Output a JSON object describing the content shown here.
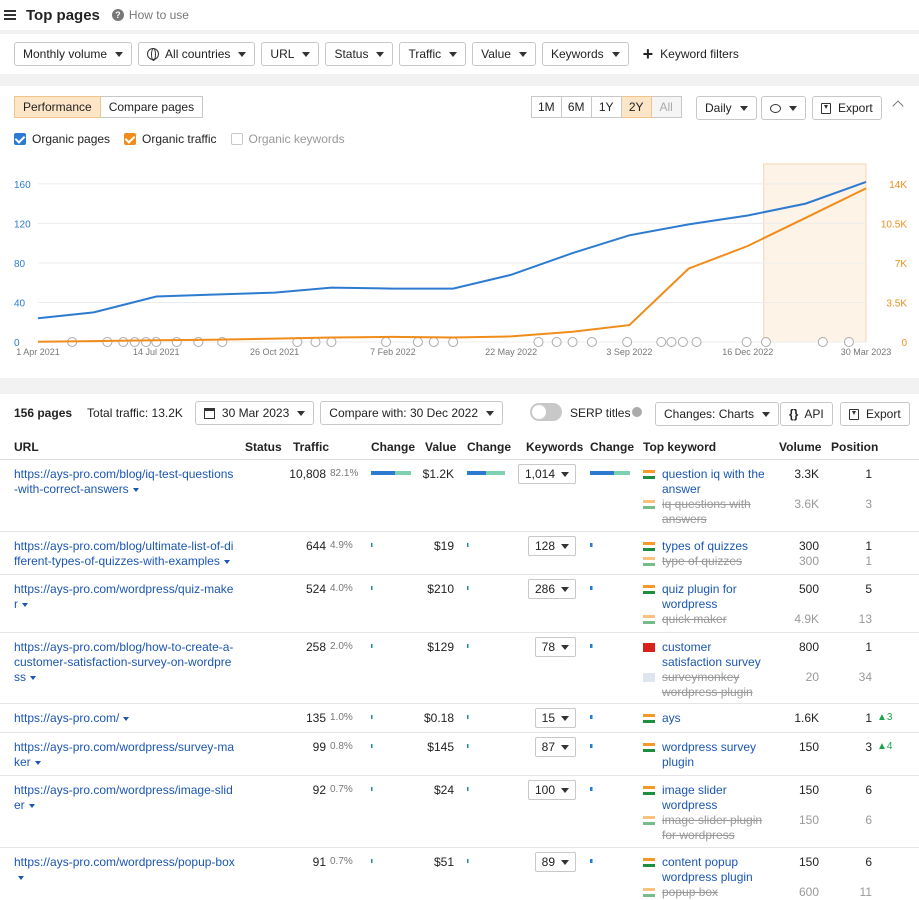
{
  "header": {
    "title": "Top pages",
    "help": "How to use"
  },
  "filters": [
    "Monthly volume",
    "All countries",
    "URL",
    "Status",
    "Traffic",
    "Value",
    "Keywords"
  ],
  "keyword_filters": "Keyword filters",
  "performance": {
    "tabs": [
      "Performance",
      "Compare pages"
    ],
    "ranges": [
      "1M",
      "6M",
      "1Y",
      "2Y",
      "All"
    ],
    "granularity": "Daily",
    "export": "Export",
    "legend": [
      "Organic pages",
      "Organic traffic",
      "Organic keywords"
    ],
    "colors": {
      "pages": "#2d7bd0",
      "traffic": "#f08c1a",
      "highlight": "#fdf3e7"
    }
  },
  "chart_data": {
    "type": "line",
    "x_labels": [
      "1 Apr 2021",
      "14 Jul 2021",
      "26 Oct 2021",
      "7 Feb 2022",
      "22 May 2022",
      "3 Sep 2022",
      "16 Dec 2022",
      "30 Mar 2023"
    ],
    "y_left_ticks": [
      "0",
      "40",
      "80",
      "120",
      "160"
    ],
    "y_right_ticks": [
      "0",
      "3.5K",
      "7K",
      "10.5K",
      "14K"
    ],
    "ylim_left": [
      0,
      170
    ],
    "ylim_right": [
      0,
      14875
    ],
    "highlight_range": [
      "30 Dec 2022",
      "30 Mar 2023"
    ],
    "series": [
      {
        "name": "Organic pages",
        "axis": "left",
        "x": [
          "1 Apr 2021",
          "20 May 2021",
          "14 Jul 2021",
          "1 Sep 2021",
          "26 Oct 2021",
          "15 Dec 2021",
          "7 Feb 2022",
          "1 Apr 2022",
          "22 May 2022",
          "15 Jul 2022",
          "3 Sep 2022",
          "25 Oct 2022",
          "16 Dec 2022",
          "5 Feb 2023",
          "30 Mar 2023"
        ],
        "values": [
          24,
          30,
          46,
          48,
          50,
          55,
          54,
          54,
          68,
          90,
          108,
          119,
          128,
          140,
          162
        ]
      },
      {
        "name": "Organic traffic",
        "axis": "right",
        "x": [
          "1 Apr 2021",
          "20 May 2021",
          "14 Jul 2021",
          "1 Sep 2021",
          "26 Oct 2021",
          "15 Dec 2021",
          "7 Feb 2022",
          "1 Apr 2022",
          "22 May 2022",
          "15 Jul 2022",
          "3 Sep 2022",
          "25 Oct 2022",
          "16 Dec 2022",
          "5 Feb 2023",
          "30 Mar 2023"
        ],
        "values": [
          30,
          80,
          150,
          200,
          300,
          400,
          450,
          400,
          500,
          900,
          1500,
          6500,
          8500,
          11000,
          13600
        ]
      }
    ]
  },
  "table": {
    "pages_count": "156 pages",
    "total_traffic": "Total traffic: 13.2K",
    "date": "30 Mar 2023",
    "compare": "Compare with: 30 Dec 2022",
    "serp_titles": "SERP titles",
    "changes": "Changes: Charts",
    "api": "API",
    "export": "Export",
    "columns": [
      "URL",
      "Status",
      "Traffic",
      "Change",
      "Value",
      "Change",
      "Keywords",
      "Change",
      "Top keyword",
      "Volume",
      "Position"
    ],
    "rows": [
      {
        "url": "https://ays-pro.com/blog/iq-test-questions-with-correct-answers",
        "traffic": "10,808",
        "pct": "82.1%",
        "value": "$1.2K",
        "keywords": "1,014",
        "kws": [
          {
            "text": "question iq with the answer",
            "vol": "3.3K",
            "pos": "1",
            "flag": "in"
          },
          {
            "text": "iq questions with answers",
            "vol": "3.6K",
            "pos": "3",
            "flag": "in"
          }
        ]
      },
      {
        "url": "https://ays-pro.com/blog/ultimate-list-of-different-types-of-quizzes-with-examples",
        "traffic": "644",
        "pct": "4.9%",
        "value": "$19",
        "keywords": "128",
        "kws": [
          {
            "text": "types of quizzes",
            "vol": "300",
            "pos": "1",
            "flag": "in"
          },
          {
            "text": "type of quizzes",
            "vol": "300",
            "pos": "1",
            "flag": "in"
          }
        ]
      },
      {
        "url": "https://ays-pro.com/wordpress/quiz-maker",
        "traffic": "524",
        "pct": "4.0%",
        "value": "$210",
        "keywords": "286",
        "kws": [
          {
            "text": "quiz plugin for wordpress",
            "vol": "500",
            "pos": "5",
            "flag": "in"
          },
          {
            "text": "quick maker",
            "vol": "4.9K",
            "pos": "13",
            "flag": "in"
          }
        ]
      },
      {
        "url": "https://ays-pro.com/blog/how-to-create-a-customer-satisfaction-survey-on-wordpress",
        "traffic": "258",
        "pct": "2.0%",
        "value": "$129",
        "keywords": "78",
        "kws": [
          {
            "text": "customer satisfaction survey",
            "vol": "800",
            "pos": "1",
            "flag": "vn"
          },
          {
            "text": "surveymonkey wordpress plugin",
            "vol": "20",
            "pos": "34",
            "flag": "us"
          }
        ]
      },
      {
        "url": "https://ays-pro.com/",
        "traffic": "135",
        "pct": "1.0%",
        "value": "$0.18",
        "keywords": "15",
        "kws": [
          {
            "text": "ays",
            "vol": "1.6K",
            "pos": "1",
            "flag": "in",
            "up": "▲3"
          }
        ]
      },
      {
        "url": "https://ays-pro.com/wordpress/survey-maker",
        "traffic": "99",
        "pct": "0.8%",
        "value": "$145",
        "keywords": "87",
        "kws": [
          {
            "text": "wordpress survey plugin",
            "vol": "150",
            "pos": "3",
            "flag": "in",
            "up": "▲4"
          }
        ]
      },
      {
        "url": "https://ays-pro.com/wordpress/image-slider",
        "traffic": "92",
        "pct": "0.7%",
        "value": "$24",
        "keywords": "100",
        "kws": [
          {
            "text": "image slider wordpress",
            "vol": "150",
            "pos": "6",
            "flag": "in"
          },
          {
            "text": "image slider plugin for wordpress",
            "vol": "150",
            "pos": "6",
            "flag": "in"
          }
        ]
      },
      {
        "url": "https://ays-pro.com/wordpress/popup-box",
        "traffic": "91",
        "pct": "0.7%",
        "value": "$51",
        "keywords": "89",
        "kws": [
          {
            "text": "content popup wordpress plugin",
            "vol": "150",
            "pos": "6",
            "flag": "in"
          },
          {
            "text": "popup box",
            "vol": "600",
            "pos": "11",
            "flag": "in"
          }
        ]
      }
    ]
  }
}
